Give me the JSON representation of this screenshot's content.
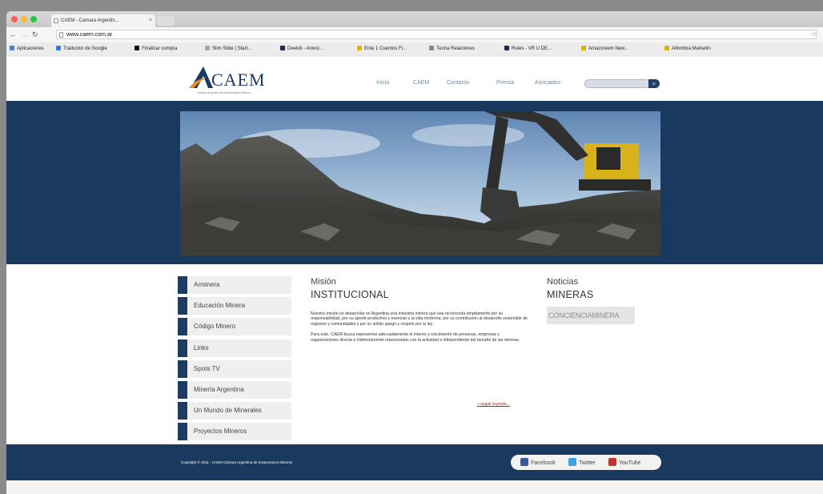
{
  "browser": {
    "tab_title": "CAEM - Camara Argentin...",
    "tab_close": "×",
    "url": "www.caem.com.ar",
    "back_icon": "arrow-left-icon",
    "forward_icon": "arrow-right-icon",
    "reload_icon": "reload-icon",
    "star_icon": "star-icon",
    "bookmarks": [
      {
        "label": "Aplicaciones",
        "color": "#4a7fd0"
      },
      {
        "label": "Traductor de Google",
        "color": "#3c7be0"
      },
      {
        "label": "Finalizar compra",
        "color": "#111111"
      },
      {
        "label": "Slim Slide | Start...",
        "color": "#a8a8a8"
      },
      {
        "label": "Deetoli - Anwsl...",
        "color": "#1a2a4a"
      },
      {
        "label": "Ente 1 Cuentos Fi...",
        "color": "#e0b400"
      },
      {
        "label": "Teoria Relaciones",
        "color": "#888888"
      },
      {
        "label": "Rules - VR U DE...",
        "color": "#1a2a4a"
      },
      {
        "label": "Amazoniem New...",
        "color": "#d8b000"
      },
      {
        "label": "Alfombra Marketin",
        "color": "#e0b400"
      }
    ]
  },
  "site": {
    "logo": "CAEM",
    "logo_sub": "Cámara Argentina de Empresarios Mineros",
    "nav": [
      "Inicio",
      "CAEM",
      "Contacto",
      "Prensa",
      "Asociados"
    ],
    "search_icon": "search-icon",
    "search_glyph": "⌕",
    "menu": [
      "Arminera",
      "Educación Minera",
      "Código Minero",
      "Links",
      "Spots TV",
      "Minería Argentina",
      "Un Mundo de Minerales",
      "Proyectos Mineros"
    ],
    "mision": {
      "title_small": "Misión",
      "title_big": "INSTITUCIONAL",
      "p1": "Nuestra misión es desarrollar en Argentina una industria minera que sea reconocida ampliamente por su responsabilidad, por su aporte productivo y esencial a la vida moderna, por su contribución al desarrollo sostenible de regiones y comunidades y por su sólido apego y respeto por la ley.",
      "p2": "Para esto, CAEM busca representar adecuadamente el interés y crecimiento de personas, empresas y organizaciones directa e indirectamente relacionadas con la actividad e independiente del tamaño de las mismas.",
      "more": "» seguir leyendo..."
    },
    "noticias": {
      "title_small": "Noticias",
      "title_big": "MINERAS",
      "badge": "CONCIENCIAMINERA"
    },
    "footer": {
      "copyright": "Copyright © 2011 - CAEM Cámara Argentina de Empresarios Mineros",
      "social": [
        {
          "label": "Facebook",
          "color": "#3b5998"
        },
        {
          "label": "Twitter",
          "color": "#3aa3e0"
        },
        {
          "label": "YouTube",
          "color": "#c4302b"
        }
      ]
    }
  }
}
